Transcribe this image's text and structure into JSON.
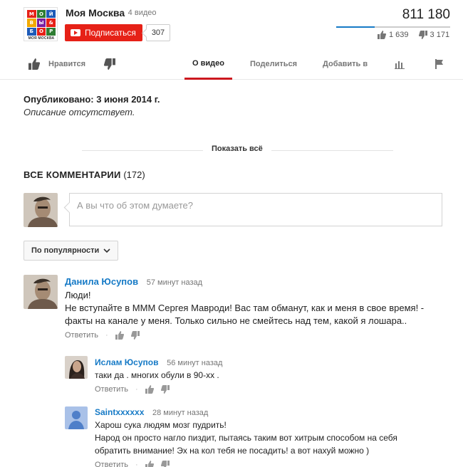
{
  "channel": {
    "name": "Моя Москва",
    "video_count": "4 видео",
    "subscribe_label": "Подписаться",
    "subscriber_count": "307",
    "logo": {
      "cells": [
        "М",
        "О",
        "Й",
        "В",
        "Ы",
        "&",
        "Б",
        "О",
        "Р"
      ],
      "caption": "МОЯ МОСКВА",
      "colors": [
        "#e62117",
        "#2e7d32",
        "#1e5bb8",
        "#f2a900",
        "#7b1fa2",
        "#e62117",
        "#1e5bb8",
        "#e62117",
        "#2e7d32"
      ]
    }
  },
  "stats": {
    "views": "811 180",
    "likes": "1 639",
    "dislikes": "3 171",
    "like_ratio": 0.34
  },
  "tabs": {
    "like_label": "Нравится",
    "about": "О видео",
    "share": "Поделиться",
    "add_to": "Добавить в"
  },
  "description": {
    "published": "Опубликовано: 3 июня 2014 г.",
    "text": "Описание отсутствует.",
    "show_more": "Показать всё"
  },
  "comments_section": {
    "title": "ВСЕ КОММЕНТАРИИ",
    "count": "(172)",
    "input_placeholder": "А вы что об этом думаете?",
    "sort_label": "По популярности",
    "reply_label": "Ответить",
    "comments": [
      {
        "author": "Данила Юсупов",
        "time": "57 минут назад",
        "lines": [
          "Люди!",
          "Не вступайте в МММ Сергея Мавроди! Вас там обманут, как и меня в свое время! -",
          "факты на канале у меня. Только сильно не смейтесь над тем, какой я лошара.."
        ]
      },
      {
        "author": "Ислам Юсупов",
        "time": "56 минут назад",
        "lines": [
          "таки да . многих обули в 90-хх ."
        ]
      },
      {
        "author": "Saintxxxxxx",
        "time": "28 минут назад",
        "lines": [
          "Харош сука людям мозг пудрить!",
          "Народ он просто нагло пиздит, пытаясь таким вот хитрым способом на себя",
          "обратить внимание! Эх на кол тебя не посадить! а вот нахуй можно )"
        ]
      }
    ]
  },
  "colors": {
    "brand_red": "#e62117",
    "link_blue": "#167ac6",
    "tab_underline": "#cc181e"
  }
}
